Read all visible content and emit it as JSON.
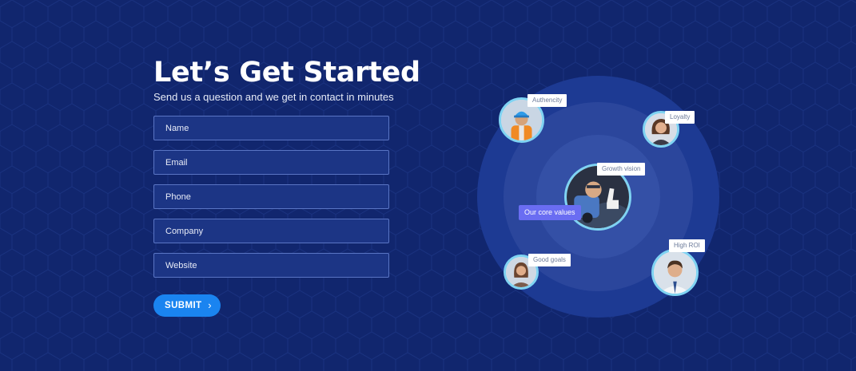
{
  "hero": {
    "title": "Let’s Get Started",
    "subtitle": "Send us a question and we get in contact in minutes"
  },
  "form": {
    "fields": [
      {
        "placeholder": "Name"
      },
      {
        "placeholder": "Email"
      },
      {
        "placeholder": "Phone"
      },
      {
        "placeholder": "Company"
      },
      {
        "placeholder": "Website"
      }
    ],
    "submit_label": "SUBMIT"
  },
  "values_graphic": {
    "center_label": "Our core values",
    "tags": {
      "authencity": "Authencity",
      "loyalty": "Loyalty",
      "growth_vision": "Growth vision",
      "good_goals": "Good goals",
      "high_roi": "High ROI"
    }
  },
  "colors": {
    "background": "#11266e",
    "input_fill": "#1c3585",
    "submit": "#1a84f0",
    "accent_tag": "#6a6df2",
    "avatar_ring": "#7fd3f2"
  },
  "icons": {
    "submit_chevron": "chevron-right-icon"
  }
}
